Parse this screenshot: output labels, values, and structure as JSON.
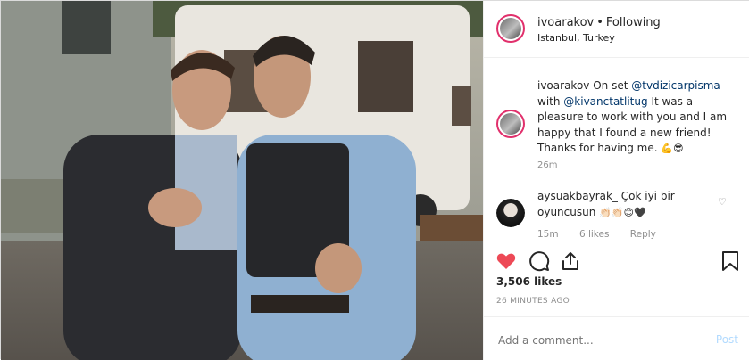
{
  "header": {
    "username": "ivoarakov",
    "separator": "•",
    "follow_status": "Following",
    "location": "Istanbul, Turkey"
  },
  "caption": {
    "username": "ivoarakov",
    "text_1": "On set",
    "mention_1": "@tvdizicarpisma",
    "text_2": "with",
    "mention_2": "@kivanctatlitug",
    "text_3": "It was a pleasure to work with you and I am happy that I found a new friend! Thanks for having me.",
    "emojis": "💪😎",
    "time": "26m"
  },
  "comment": {
    "username": "aysuakbayrak_",
    "text": "Çok iyi bir oyuncusun",
    "emojis": "👏🏻👏🏻😊🖤",
    "time": "15m",
    "likes": "6 likes",
    "reply": "Reply"
  },
  "post": {
    "likes": "3,506 likes",
    "timestamp": "26 MINUTES AGO"
  },
  "add_comment": {
    "placeholder": "Add a comment...",
    "post_label": "Post"
  },
  "icons": {
    "like": "heart-icon",
    "comment": "comment-icon",
    "share": "share-icon",
    "save": "bookmark-icon"
  },
  "colors": {
    "liked": "#ed4956",
    "mention": "#003569",
    "muted": "#8e8e8e",
    "post_disabled": "#b3dbff"
  }
}
